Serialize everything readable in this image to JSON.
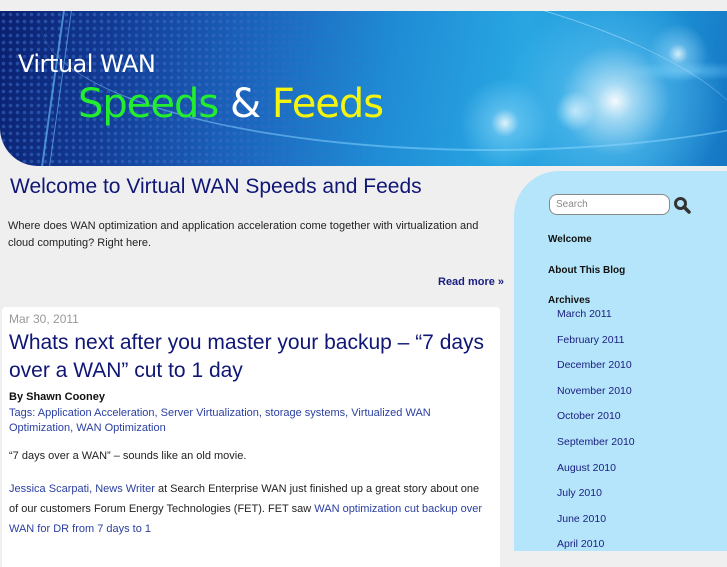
{
  "header": {
    "logo_line1": "Virtual WAN",
    "logo_word1": "Speeds",
    "logo_amp": "&",
    "logo_word2": "Feeds"
  },
  "welcome": {
    "title": "Welcome to Virtual WAN Speeds and Feeds",
    "text": "Where does WAN optimization and application acceleration come together with virtualization and cloud computing? Right here.",
    "read_more": "Read more »"
  },
  "post": {
    "date": "Mar 30, 2011",
    "title": "Whats next after you master your backup – “7 days over a WAN” cut to 1 day",
    "author": "By Shawn Cooney",
    "tags_label": "Tags: ",
    "tags": [
      "Application Acceleration",
      "Server Virtualization",
      "storage systems",
      "Virtualized WAN Optimization",
      "WAN Optimization"
    ],
    "body_intro": "“7 days over a WAN” – sounds like an old movie.",
    "body_link1": "Jessica Scarpati, News Writer",
    "body_text1": " at Search Enterprise WAN just finished up a great story about one of our customers  Forum Energy Technologies (FET). FET saw ",
    "body_link2": "WAN optimization cut backup over WAN for DR from 7 days to 1"
  },
  "sidebar": {
    "search_placeholder": "Search",
    "links": [
      "Welcome",
      "About This Blog"
    ],
    "archives_heading": "Archives",
    "archives": [
      "March 2011",
      "February 2011",
      "December 2010",
      "November 2010",
      "October 2010",
      "September 2010",
      "August 2010",
      "July 2010",
      "June 2010",
      "April 2010"
    ]
  },
  "colors": {
    "title_blue": "#0f1675",
    "link_blue": "#2a3fa0",
    "sidebar_bg": "#b5e5fa",
    "page_bg": "#efefef",
    "logo_green": "#22ee2e",
    "logo_yellow": "#f4f40e"
  }
}
